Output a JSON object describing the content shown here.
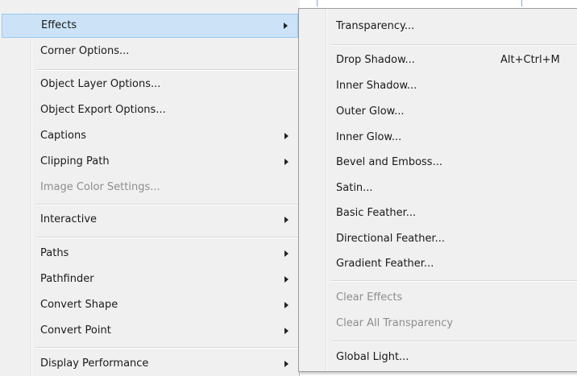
{
  "main_menu": {
    "items": [
      {
        "label": "Effects",
        "submenu": true,
        "highlight": true
      },
      {
        "label": "Corner Options..."
      },
      {
        "label": "Object Layer Options..."
      },
      {
        "label": "Object Export Options..."
      },
      {
        "label": "Captions",
        "submenu": true
      },
      {
        "label": "Clipping Path",
        "submenu": true
      },
      {
        "label": "Image Color Settings...",
        "disabled": true
      },
      {
        "label": "Interactive",
        "submenu": true
      },
      {
        "label": "Paths",
        "submenu": true
      },
      {
        "label": "Pathfinder",
        "submenu": true
      },
      {
        "label": "Convert Shape",
        "submenu": true
      },
      {
        "label": "Convert Point",
        "submenu": true
      },
      {
        "label": "Display Performance",
        "submenu": true
      }
    ]
  },
  "effects_submenu": {
    "items": [
      {
        "label": "Transparency..."
      },
      {
        "label": "Drop Shadow...",
        "shortcut": "Alt+Ctrl+M"
      },
      {
        "label": "Inner Shadow..."
      },
      {
        "label": "Outer Glow..."
      },
      {
        "label": "Inner Glow..."
      },
      {
        "label": "Bevel and Emboss..."
      },
      {
        "label": "Satin..."
      },
      {
        "label": "Basic Feather..."
      },
      {
        "label": "Directional Feather..."
      },
      {
        "label": "Gradient Feather..."
      },
      {
        "label": "Clear Effects",
        "disabled": true
      },
      {
        "label": "Clear All Transparency",
        "disabled": true
      },
      {
        "label": "Global Light..."
      }
    ]
  },
  "colors": {
    "menu_bg": "#f0f0f0",
    "highlight_bg": "#cce3f7",
    "highlight_border": "#99c9ef",
    "disabled_text": "#8d8d8d"
  }
}
